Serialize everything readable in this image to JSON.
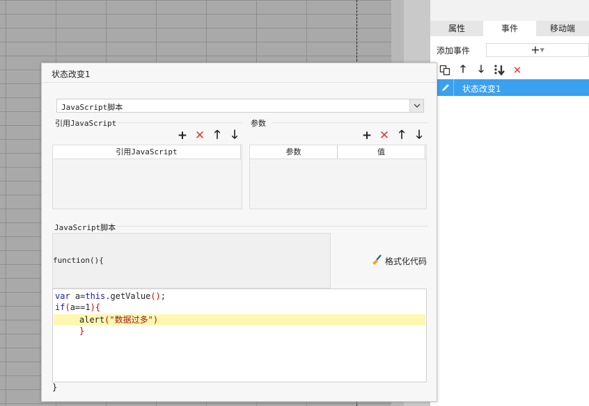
{
  "right_panel": {
    "tabs": [
      "属性",
      "事件",
      "移动端"
    ],
    "active_tab": "事件",
    "add_event_label": "添加事件",
    "add_event_button": "+",
    "event_item": "状态改变1"
  },
  "dialog": {
    "title": "状态改变1",
    "script_type": "JavaScript脚本",
    "ref_js_label": "引用JavaScript",
    "params_label": "参数",
    "ref_js_header": "引用JavaScript",
    "params_headers": [
      "参数",
      "值"
    ],
    "js_section_label": "JavaScript脚本",
    "function_header": "function(){",
    "format_button": "格式化代码",
    "closing_brace": "}"
  },
  "code": {
    "line1_kw": "var",
    "line1_a": " a=",
    "line1_this": "this",
    "line1_rest": ".getValue",
    "line1_paren": "()",
    "line1_end": ";",
    "line2_if": "if",
    "line2_cond_open": "(",
    "line2_cond": "a==1",
    "line2_cond_close": ")",
    "line2_brace": "{",
    "line3_fn": "alert",
    "line3_open": "(",
    "line3_str": "\"数据过多\"",
    "line3_close": ")",
    "line4_brace": "}"
  },
  "colors": {
    "selection": "#3aa0f0",
    "danger": "#e53935",
    "highlight": "#fdf7b2"
  }
}
